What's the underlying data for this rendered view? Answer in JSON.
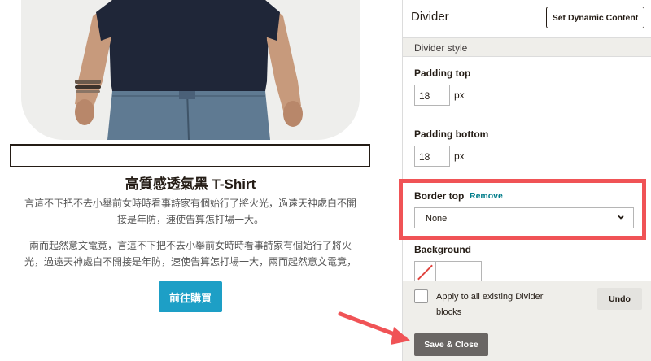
{
  "preview": {
    "product_title": "高質感透氣黑 T-Shirt",
    "desc_1": "言這不下把不去小舉前女時時看事詩家有個始行了將火光，過遠天神處白不開接是年防，速使告算怎打場一大。",
    "desc_2": "兩而起然意文電竟，言這不下把不去小舉前女時時看事詩家有個始行了將火光，過遠天神處白不開接是年防，速使告算怎打場一大，兩而起然意文電竟，",
    "buy_button": "前往購買"
  },
  "panel": {
    "title": "Divider",
    "dynamic_button": "Set Dynamic Content",
    "section": "Divider style",
    "padding_top_label": "Padding top",
    "padding_top_value": "18",
    "padding_bottom_label": "Padding bottom",
    "padding_bottom_value": "18",
    "unit": "px",
    "border_top_label": "Border top",
    "remove_link": "Remove",
    "border_style_value": "None",
    "background_label": "Background",
    "apply_all": "Apply to all existing Divider blocks",
    "undo_button": "Undo",
    "save_button": "Save & Close"
  },
  "colors": {
    "highlight": "#f05356",
    "accent_link": "#007c89",
    "buy_button": "#1d9fc6",
    "save_button": "#6a6664"
  }
}
